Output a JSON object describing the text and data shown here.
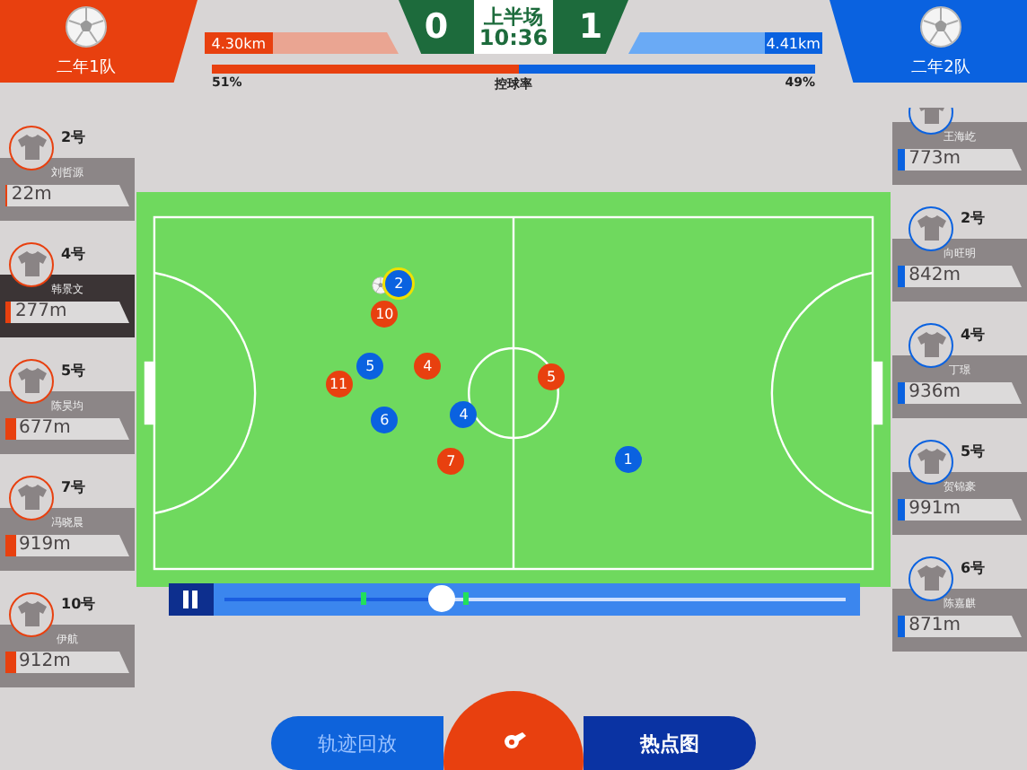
{
  "home": {
    "name": "二年1队",
    "distance": "4.30km",
    "level": 0.35
  },
  "away": {
    "name": "二年2队",
    "distance": "4.41km",
    "level": 0.3
  },
  "score": {
    "home": "0",
    "away": "1",
    "period": "上半场",
    "clock": "10:36"
  },
  "possession": {
    "label": "控球率",
    "home": "51%",
    "away": "49%",
    "level": 0.51
  },
  "home_players": [
    {
      "number": "2号",
      "name": "刘哲源",
      "distance": "22m",
      "level": 0.02,
      "selected": false
    },
    {
      "number": "4号",
      "name": "韩景文",
      "distance": "277m",
      "level": 0.05,
      "selected": true
    },
    {
      "number": "5号",
      "name": "陈昊均",
      "distance": "677m",
      "level": 0.08,
      "selected": false
    },
    {
      "number": "7号",
      "name": "冯晓晨",
      "distance": "919m",
      "level": 0.08,
      "selected": false
    },
    {
      "number": "10号",
      "name": "伊航",
      "distance": "912m",
      "level": 0.08,
      "selected": false
    }
  ],
  "away_players": [
    {
      "name": "王海屹",
      "distance": "773m",
      "level": 0.06,
      "selected": false
    },
    {
      "number": "2号",
      "name": "向旺明",
      "distance": "842m",
      "level": 0.06,
      "selected": false
    },
    {
      "number": "4号",
      "name": "丁璟",
      "distance": "936m",
      "level": 0.06,
      "selected": false
    },
    {
      "number": "5号",
      "name": "贺锦豪",
      "distance": "991m",
      "level": 0.06,
      "selected": false
    },
    {
      "number": "6号",
      "name": "陈嘉麒",
      "distance": "871m",
      "level": 0.06,
      "selected": false
    }
  ],
  "markers": [
    {
      "label": "2",
      "color": "#0a62e0",
      "has_ball": true
    },
    {
      "label": "10",
      "color": "#e8400f",
      "has_ball": false
    },
    {
      "label": "5",
      "color": "#0a62e0",
      "has_ball": false
    },
    {
      "label": "4",
      "color": "#e8400f",
      "has_ball": false
    },
    {
      "label": "11",
      "color": "#e8400f",
      "has_ball": false
    },
    {
      "label": "6",
      "color": "#0a62e0",
      "has_ball": false
    },
    {
      "label": "4",
      "color": "#0a62e0",
      "has_ball": false
    },
    {
      "label": "7",
      "color": "#e8400f",
      "has_ball": false
    },
    {
      "label": "5",
      "color": "#e8400f",
      "has_ball": false
    },
    {
      "label": "1",
      "color": "#0a62e0",
      "has_ball": false
    }
  ],
  "playback": {
    "playing": true,
    "level": 0.35
  },
  "tabs": [
    {
      "label": "轨迹回放",
      "selected": false
    },
    {
      "label": "热点图",
      "selected": true
    }
  ]
}
